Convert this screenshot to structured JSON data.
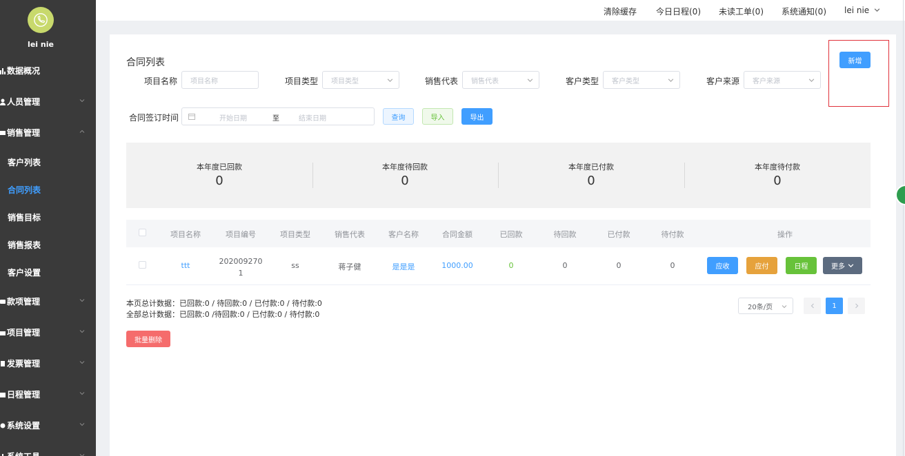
{
  "user": {
    "name": "lei nie"
  },
  "sidebar": {
    "items": [
      {
        "label": "数据概况",
        "expandable": false
      },
      {
        "label": "人员管理",
        "expandable": true
      },
      {
        "label": "销售管理",
        "expandable": true,
        "expanded": true
      },
      {
        "label": "款项管理",
        "expandable": true
      },
      {
        "label": "项目管理",
        "expandable": true
      },
      {
        "label": "发票管理",
        "expandable": true
      },
      {
        "label": "日程管理",
        "expandable": true
      },
      {
        "label": "系统设置",
        "expandable": true
      },
      {
        "label": "系统工具",
        "expandable": true
      }
    ],
    "sales_sub": [
      "客户列表",
      "合同列表",
      "销售目标",
      "销售报表",
      "客户设置"
    ],
    "active_sub": "合同列表"
  },
  "topbar": {
    "clear_cache": "清除缓存",
    "today_schedule": "今日日程(0)",
    "unread_orders": "未读工单(0)",
    "system_notice": "系统通知(0)",
    "user_menu": "lei nie"
  },
  "page": {
    "title": "合同列表"
  },
  "filters": {
    "project_name": {
      "label": "项目名称",
      "placeholder": "项目名称"
    },
    "project_type": {
      "label": "项目类型",
      "placeholder": "项目类型"
    },
    "sales_rep": {
      "label": "销售代表",
      "placeholder": "销售代表"
    },
    "customer_type": {
      "label": "客户类型",
      "placeholder": "客户类型"
    },
    "customer_source": {
      "label": "客户来源",
      "placeholder": "客户来源"
    },
    "sign_time": {
      "label": "合同签订时间",
      "start_placeholder": "开始日期",
      "separator": "至",
      "end_placeholder": "结束日期"
    }
  },
  "buttons": {
    "query": "查询",
    "import": "导入",
    "export": "导出",
    "new": "新增",
    "batch_delete": "批量删除"
  },
  "stats": [
    {
      "label": "本年度已回款",
      "value": "0"
    },
    {
      "label": "本年度待回款",
      "value": "0"
    },
    {
      "label": "本年度已付款",
      "value": "0"
    },
    {
      "label": "本年度待付款",
      "value": "0"
    }
  ],
  "table": {
    "headers": [
      "项目名称",
      "项目编号",
      "项目类型",
      "销售代表",
      "客户名称",
      "合同金额",
      "已回款",
      "待回款",
      "已付款",
      "待付款",
      "操作"
    ],
    "rows": [
      {
        "project_name": "ttt",
        "project_no_line1": "202009270",
        "project_no_line2": "1",
        "project_type": "ss",
        "sales_rep": "蒋子健",
        "customer": "是是是",
        "amount": "1000.00",
        "received": "0",
        "to_receive": "0",
        "paid": "0",
        "to_pay": "0"
      }
    ],
    "actions": {
      "receivable": "应收",
      "payable": "应付",
      "schedule": "日程",
      "more": "更多"
    }
  },
  "summary": {
    "page": "本页总计数据：已回款:0 / 待回款:0 / 已付款:0 / 待付款:0",
    "all": "全部总计数据：已回款:0 /待回款:0 / 已付款:0 / 待付款:0"
  },
  "pagination": {
    "page_size": "20条/页",
    "current_page": "1"
  },
  "colors": {
    "primary": "#409eff",
    "success": "#67c23a",
    "warning": "#e6a23c",
    "danger": "#f56c6c",
    "info": "#5c6b7f",
    "sidebar": "#3a3a3a"
  }
}
